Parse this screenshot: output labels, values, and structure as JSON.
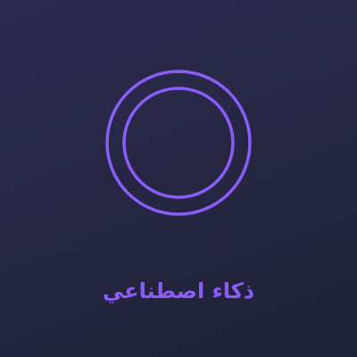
{
  "colors": {
    "background_start": "#2c2a4f",
    "background_end": "#1f2237",
    "accent": "#8b5cf6"
  },
  "icon": "concentric-rings-icon",
  "caption": "ذكاء اصطناعي"
}
